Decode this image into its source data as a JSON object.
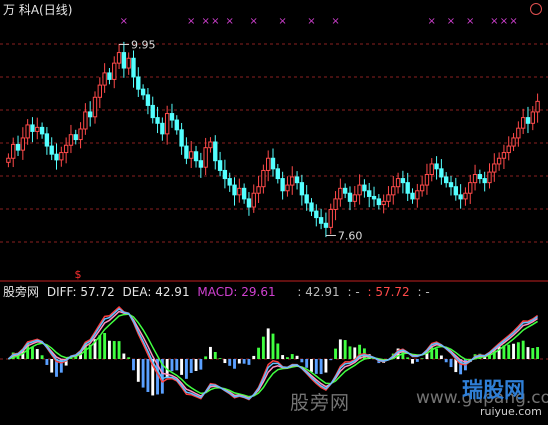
{
  "header": {
    "title": "万 科A(日线)",
    "indicator_name": "股旁网",
    "diff_label": "DIFF: 57.72",
    "dea_label": "DEA: 42.91",
    "macd_label": "MACD: 29.61",
    "extra_a": ": 42.91",
    "extra_b": ": -",
    "extra_c": ": 57.72",
    "extra_d": ": -"
  },
  "watermark": {
    "cn": "股旁网",
    "url": "www.gupang.com",
    "logo_text": "瑞股网",
    "logo_url": "ruiyue.com"
  },
  "colors": {
    "up": "#ff4a4a",
    "down": "#54ffff",
    "grid": "#8a1f1f",
    "signal_marker": "#d040d0",
    "diff_line": "#ff4040",
    "dea_line": "#40ff40",
    "macd_pos": "#40ff40",
    "macd_neg": "#5aa0ff"
  },
  "chart_data": [
    {
      "type": "candlestick",
      "title": "万 科A(日线)",
      "annotations": [
        {
          "label": "9.95",
          "value": 9.95,
          "kind": "high"
        },
        {
          "label": "7.60",
          "value": 7.6,
          "kind": "low"
        }
      ],
      "ylim": [
        7.2,
        10.3
      ],
      "grid": true,
      "markers_label": "×",
      "marker_bars": [
        24,
        38,
        41,
        43,
        46,
        51,
        57,
        63,
        68,
        88,
        92,
        96,
        101,
        103,
        105,
        113,
        118,
        123
      ],
      "close": [
        8.55,
        8.72,
        8.65,
        8.8,
        8.96,
        8.88,
        8.93,
        8.85,
        8.7,
        8.6,
        8.53,
        8.62,
        8.71,
        8.84,
        8.78,
        8.91,
        9.12,
        9.06,
        9.3,
        9.45,
        9.6,
        9.52,
        9.72,
        9.85,
        9.66,
        9.78,
        9.55,
        9.4,
        9.33,
        9.2,
        9.05,
        8.98,
        8.85,
        9.1,
        9.02,
        8.9,
        8.7,
        8.55,
        8.63,
        8.52,
        8.44,
        8.68,
        8.75,
        8.52,
        8.4,
        8.3,
        8.22,
        8.1,
        8.18,
        8.05,
        7.95,
        8.12,
        8.2,
        8.4,
        8.55,
        8.42,
        8.3,
        8.15,
        8.22,
        8.32,
        8.25,
        8.1,
        8.0,
        7.9,
        7.82,
        7.75,
        7.7,
        7.92,
        8.05,
        8.18,
        8.12,
        8.02,
        8.1,
        8.22,
        8.15,
        8.08,
        8.05,
        7.98,
        8.02,
        8.1,
        8.2,
        8.3,
        8.25,
        8.12,
        8.05,
        8.15,
        8.22,
        8.35,
        8.48,
        8.42,
        8.32,
        8.25,
        8.2,
        8.1,
        8.05,
        8.12,
        8.25,
        8.35,
        8.3,
        8.25,
        8.38,
        8.48,
        8.55,
        8.62,
        8.7,
        8.8,
        8.92,
        9.05,
        8.98,
        9.12,
        9.25
      ]
    },
    {
      "type": "macd",
      "series": [
        {
          "name": "DIFF",
          "last": 57.72
        },
        {
          "name": "DEA",
          "last": 42.91
        },
        {
          "name": "MACD",
          "last": 29.61
        }
      ]
    }
  ]
}
